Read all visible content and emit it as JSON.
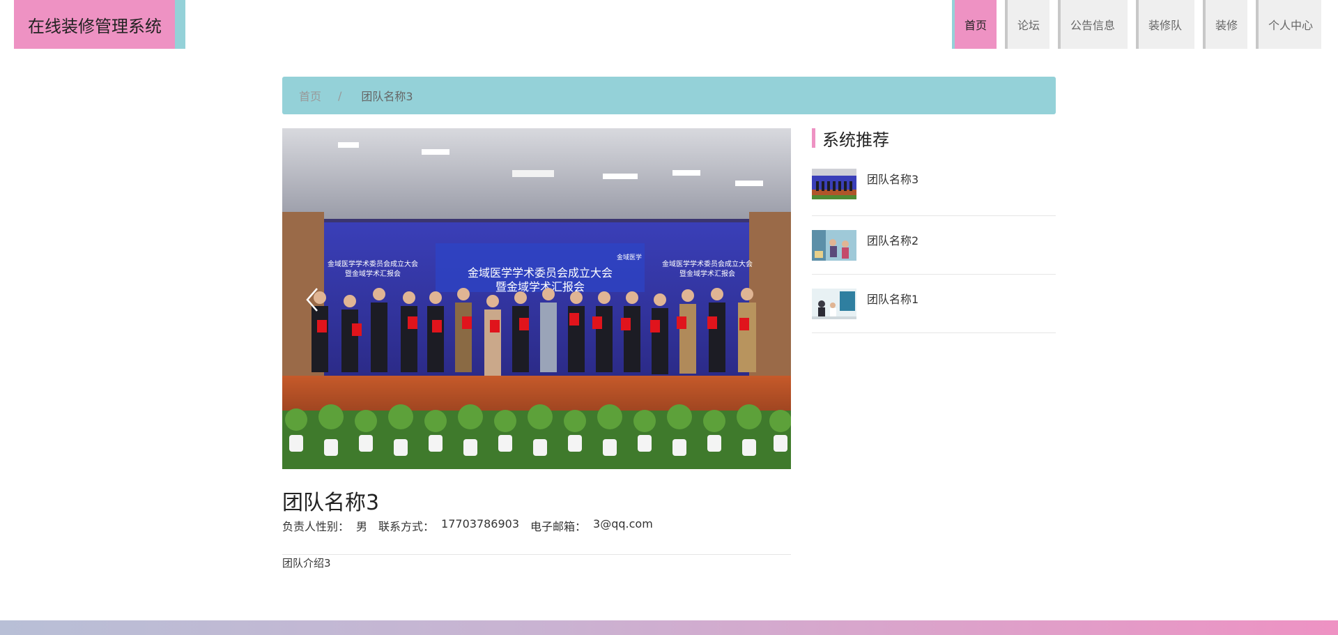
{
  "header": {
    "logo": "在线装修管理系统",
    "nav": [
      {
        "label": "首页",
        "active": true
      },
      {
        "label": "论坛",
        "active": false
      },
      {
        "label": "公告信息",
        "active": false
      },
      {
        "label": "装修队",
        "active": false
      },
      {
        "label": "装修",
        "active": false
      },
      {
        "label": "个人中心",
        "active": false
      }
    ]
  },
  "breadcrumb": {
    "home": "首页",
    "separator": "/",
    "current": "团队名称3"
  },
  "carousel": {
    "prev_icon": "chevron-left-icon",
    "banner_line1": "金域医学学术委员会成立大会",
    "banner_line2": "暨金域学术汇报会",
    "side_banner_line1": "金域医学学术委员会成立大会",
    "side_banner_line2": "暨金域学术汇报会",
    "brand": "金域医学"
  },
  "detail": {
    "title": "团队名称3",
    "gender_label": "负责人性别：",
    "gender_value": "男",
    "contact_label": "联系方式：",
    "contact_value": "17703786903",
    "email_label": "电子邮箱：",
    "email_value": "3@qq.com",
    "description": "团队介绍3"
  },
  "sidebar": {
    "title": "系统推荐",
    "items": [
      {
        "label": "团队名称3"
      },
      {
        "label": "团队名称2"
      },
      {
        "label": "团队名称1"
      }
    ]
  },
  "colors": {
    "accent_pink": "#ee92c3",
    "accent_teal": "#94d1d8"
  }
}
